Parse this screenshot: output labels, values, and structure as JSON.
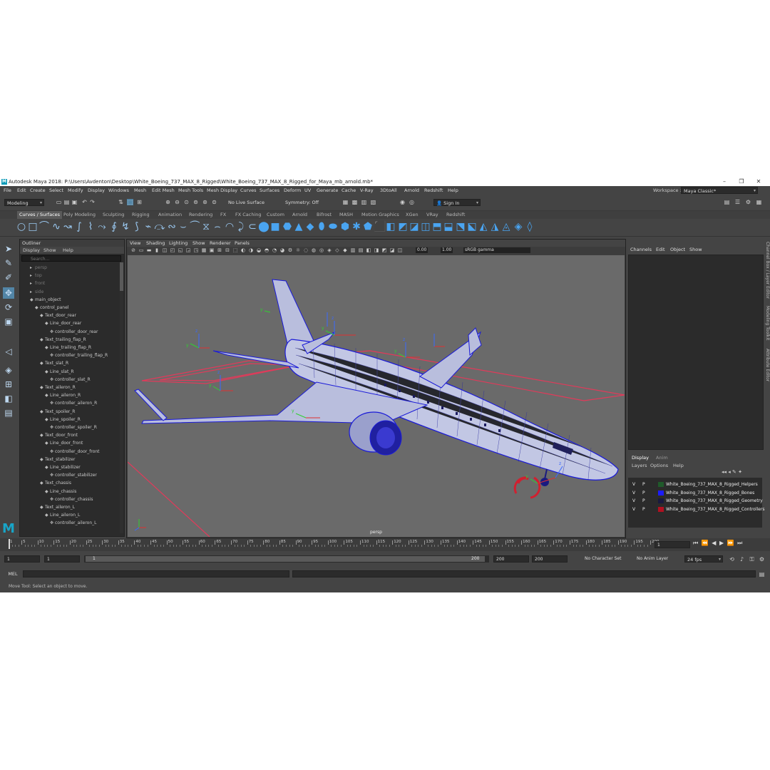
{
  "window": {
    "title": "Autodesk Maya 2018: P:\\Users\\Avdenton\\Desktop\\White_Boeing_737_MAX_8_Rigged\\White_Boeing_737_MAX_8_Rigged_for_Maya_mb_arnold.mb*",
    "logo": "M"
  },
  "menubar": [
    "File",
    "Edit",
    "Create",
    "Select",
    "Modify",
    "Display",
    "Windows",
    "Mesh",
    "Edit Mesh",
    "Mesh Tools",
    "Mesh Display",
    "Curves",
    "Surfaces",
    "Deform",
    "UV",
    "Generate",
    "Cache",
    "V-Ray",
    "3DtoAll",
    "Arnold",
    "Redshift",
    "Help"
  ],
  "workspace": {
    "label": "Workspace :",
    "value": "Maya Classic*"
  },
  "status": {
    "mode": "Modeling",
    "live_surface": "No Live Surface",
    "symmetry": "Symmetry: Off",
    "sign_in": "Sign In"
  },
  "shelf_tabs": [
    "Curves / Surfaces",
    "Poly Modeling",
    "Sculpting",
    "Rigging",
    "Animation",
    "Rendering",
    "FX",
    "FX Caching",
    "Custom",
    "Arnold",
    "Bifrost",
    "MASH",
    "Motion Graphics",
    "XGen",
    "VRay",
    "Redshift"
  ],
  "outliner": {
    "title": "Outliner",
    "menu": [
      "Display",
      "Show",
      "Help"
    ],
    "search_placeholder": "Search...",
    "items": [
      {
        "label": "persp",
        "depth": 0,
        "dim": true
      },
      {
        "label": "top",
        "depth": 0,
        "dim": true
      },
      {
        "label": "front",
        "depth": 0,
        "dim": true
      },
      {
        "label": "side",
        "depth": 0,
        "dim": true
      },
      {
        "label": "main_object",
        "depth": 0,
        "dim": false
      },
      {
        "label": "control_panel",
        "depth": 1,
        "dim": false
      },
      {
        "label": "Text_door_rear",
        "depth": 2,
        "dim": false
      },
      {
        "label": "Line_door_rear",
        "depth": 3,
        "dim": false
      },
      {
        "label": "controller_door_rear",
        "depth": 4,
        "dim": false
      },
      {
        "label": "Text_trailing_flap_R",
        "depth": 2,
        "dim": false
      },
      {
        "label": "Line_trailing_flap_R",
        "depth": 3,
        "dim": false
      },
      {
        "label": "controller_trailing_flap_R",
        "depth": 4,
        "dim": false
      },
      {
        "label": "Text_slat_R",
        "depth": 2,
        "dim": false
      },
      {
        "label": "Line_slat_R",
        "depth": 3,
        "dim": false
      },
      {
        "label": "controller_slat_R",
        "depth": 4,
        "dim": false
      },
      {
        "label": "Text_aileron_R",
        "depth": 2,
        "dim": false
      },
      {
        "label": "Line_aileron_R",
        "depth": 3,
        "dim": false
      },
      {
        "label": "controller_aileron_R",
        "depth": 4,
        "dim": false
      },
      {
        "label": "Text_spoiler_R",
        "depth": 2,
        "dim": false
      },
      {
        "label": "Line_spoiler_R",
        "depth": 3,
        "dim": false
      },
      {
        "label": "controller_spoiler_R",
        "depth": 4,
        "dim": false
      },
      {
        "label": "Text_door_front",
        "depth": 2,
        "dim": false
      },
      {
        "label": "Line_door_front",
        "depth": 3,
        "dim": false
      },
      {
        "label": "controller_door_front",
        "depth": 4,
        "dim": false
      },
      {
        "label": "Text_stabilizer",
        "depth": 2,
        "dim": false
      },
      {
        "label": "Line_stabilizer",
        "depth": 3,
        "dim": false
      },
      {
        "label": "controller_stabilizer",
        "depth": 4,
        "dim": false
      },
      {
        "label": "Text_chassis",
        "depth": 2,
        "dim": false
      },
      {
        "label": "Line_chassis",
        "depth": 3,
        "dim": false
      },
      {
        "label": "controller_chassis",
        "depth": 4,
        "dim": false
      },
      {
        "label": "Text_aileron_L",
        "depth": 2,
        "dim": false
      },
      {
        "label": "Line_aileron_L",
        "depth": 3,
        "dim": false
      },
      {
        "label": "controller_aileron_L",
        "depth": 4,
        "dim": false
      }
    ]
  },
  "viewport": {
    "menu": [
      "View",
      "Shading",
      "Lighting",
      "Show",
      "Renderer",
      "Panels"
    ],
    "exposure": "0.00",
    "gamma": "1.00",
    "color_space": "sRGB gamma",
    "camera": "persp"
  },
  "channel_box": {
    "menu": [
      "Channels",
      "Edit",
      "Object",
      "Show"
    ],
    "side_tabs": [
      "Channel Box / Layer Editor",
      "Modeling Toolkit",
      "Attribute Editor"
    ]
  },
  "layers": {
    "tabs": [
      "Display",
      "Anim"
    ],
    "menu": [
      "Layers",
      "Options",
      "Help"
    ],
    "rows": [
      {
        "v": "V",
        "p": "P",
        "name": "White_Boeing_737_MAX_8_Rigged_Helpers",
        "color": "#1f5a2a"
      },
      {
        "v": "V",
        "p": "P",
        "name": "White_Boeing_737_MAX_8_Rigged_Bones",
        "color": "#1c1cff"
      },
      {
        "v": "V",
        "p": "P",
        "name": "White_Boeing_737_MAX_8_Rigged_Geometry",
        "color": "#1a1a40"
      },
      {
        "v": "V",
        "p": "P",
        "name": "White_Boeing_737_MAX_8_Rigged_Controllers",
        "color": "#b01020"
      }
    ]
  },
  "timeline": {
    "ticks": [
      "1",
      "5",
      "10",
      "15",
      "20",
      "25",
      "30",
      "35",
      "40",
      "45",
      "50",
      "55",
      "60",
      "65",
      "70",
      "75",
      "80",
      "85",
      "90",
      "95",
      "100",
      "105",
      "110",
      "115",
      "120",
      "125",
      "130",
      "135",
      "140",
      "145",
      "150",
      "155",
      "160",
      "165",
      "170",
      "175",
      "180",
      "185",
      "190",
      "195",
      "200"
    ],
    "current_frame": "1"
  },
  "range": {
    "start": "1",
    "playback_start": "1",
    "slider_start": "1",
    "slider_end": "200",
    "playback_end": "200",
    "end": "200",
    "character_set": "No Character Set",
    "anim_layer": "No Anim Layer",
    "fps": "24 fps"
  },
  "command": {
    "label": "MEL"
  },
  "help_line": "Move Tool: Select an object to move."
}
